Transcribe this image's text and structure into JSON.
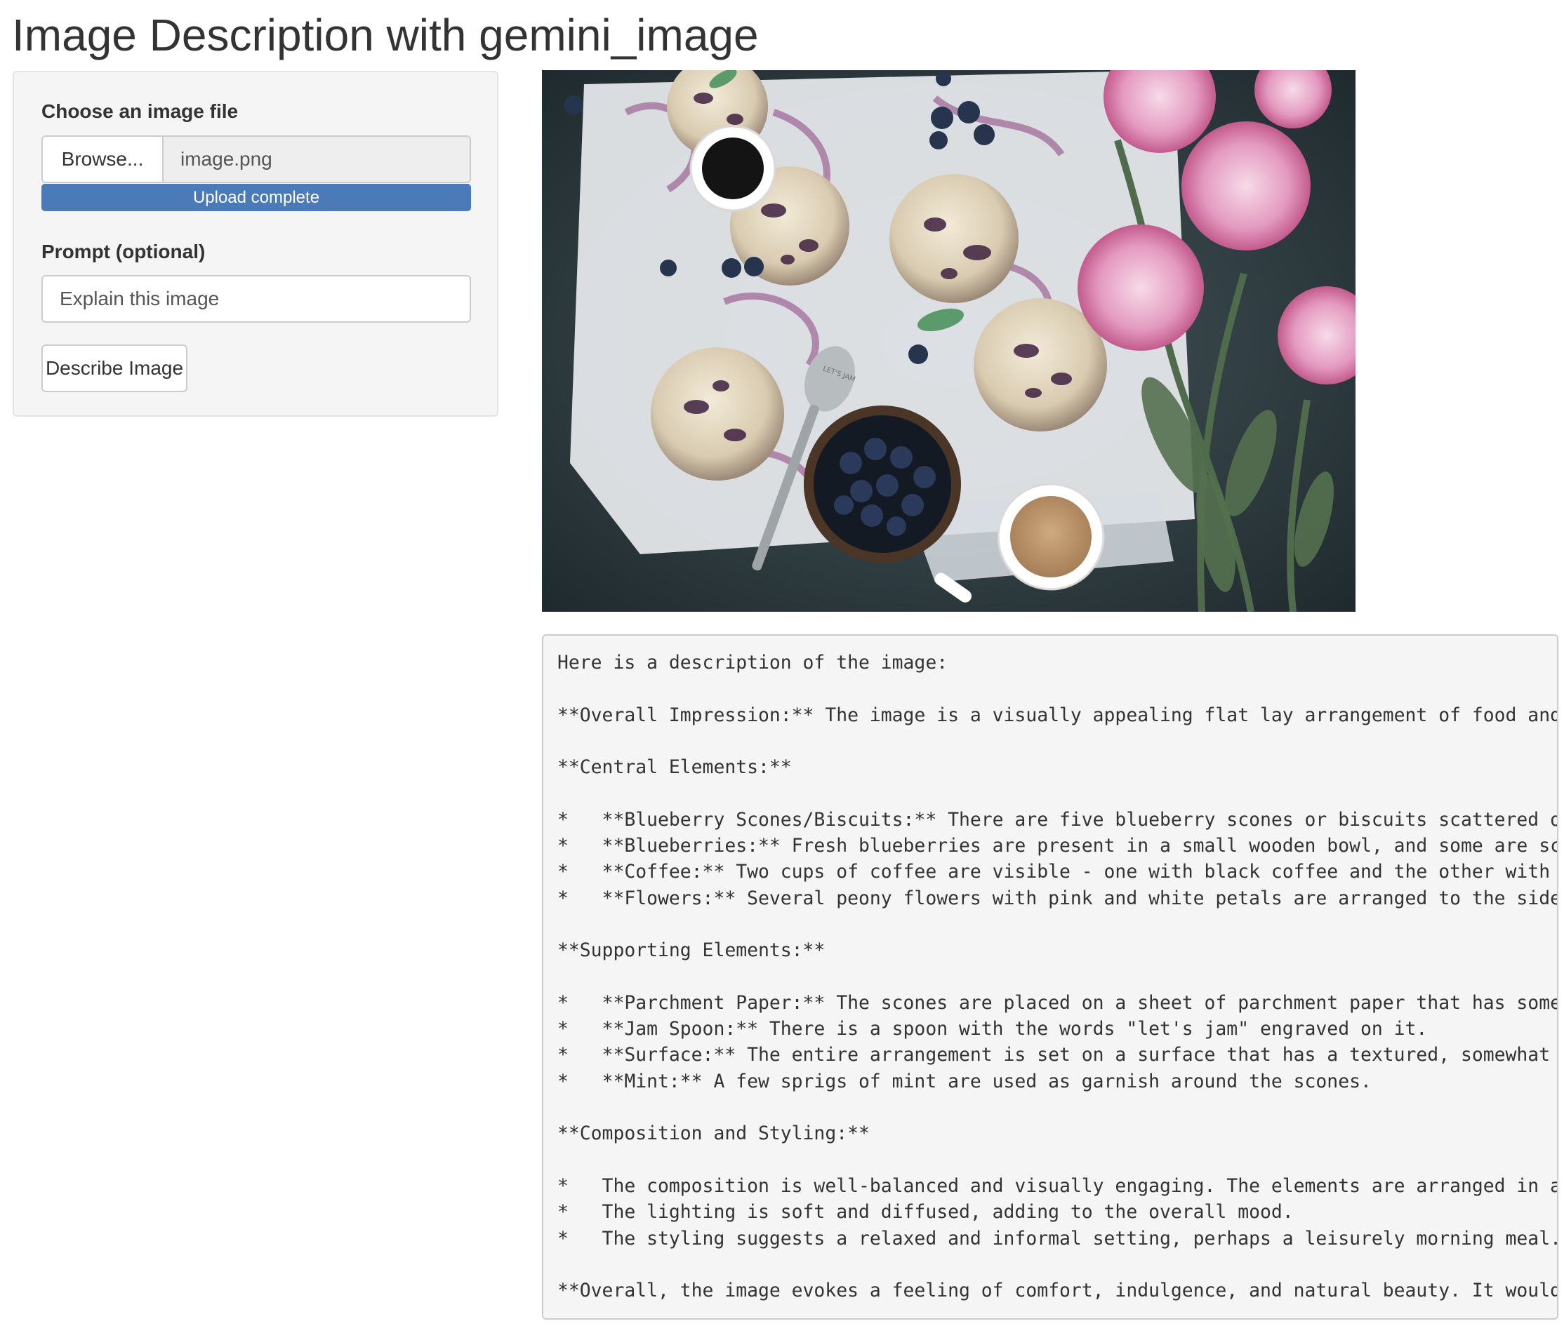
{
  "page": {
    "title": "Image Description with gemini_image"
  },
  "sidebar": {
    "file_label": "Choose an image file",
    "browse_label": "Browse...",
    "file_name": "image.png",
    "upload_status": "Upload complete",
    "upload_progress": 1.0,
    "prompt_label": "Prompt (optional)",
    "prompt_value": "Explain this image",
    "describe_button": "Describe Image"
  },
  "main": {
    "image": {
      "subject": "flat lay of blueberry scones, blueberries, coffee cups and pink peonies",
      "spoon_text": "LET'S JAM"
    },
    "output_lines": [
      "Here is a description of the image:",
      "",
      "**Overall Impression:** The image is a visually appealing flat lay arrangement of food and",
      "",
      "**Central Elements:**",
      "",
      "*   **Blueberry Scones/Biscuits:** There are five blueberry scones or biscuits scattered or",
      "*   **Blueberries:** Fresh blueberries are present in a small wooden bowl, and some are sca",
      "*   **Coffee:** Two cups of coffee are visible - one with black coffee and the other with c",
      "*   **Flowers:** Several peony flowers with pink and white petals are arranged to the side,",
      "",
      "**Supporting Elements:**",
      "",
      "*   **Parchment Paper:** The scones are placed on a sheet of parchment paper that has some",
      "*   **Jam Spoon:** There is a spoon with the words \"let's jam\" engraved on it.",
      "*   **Surface:** The entire arrangement is set on a surface that has a textured, somewhat c",
      "*   **Mint:** A few sprigs of mint are used as garnish around the scones.",
      "",
      "**Composition and Styling:**",
      "",
      "*   The composition is well-balanced and visually engaging. The elements are arranged in a",
      "*   The lighting is soft and diffused, adding to the overall mood.",
      "*   The styling suggests a relaxed and informal setting, perhaps a leisurely morning meal.",
      "",
      "**Overall, the image evokes a feeling of comfort, indulgence, and natural beauty. It would"
    ]
  },
  "colors": {
    "accent": "#4a7ab8",
    "panel_bg": "#f5f5f5",
    "border": "#cccccc"
  }
}
